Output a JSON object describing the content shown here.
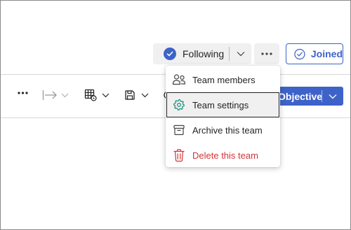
{
  "header": {
    "following": {
      "label": "Following",
      "checked": true
    },
    "more_label": "More options",
    "joined": {
      "label": "Joined"
    }
  },
  "toolbar": {
    "objective_label": "Objective"
  },
  "menu": {
    "items": [
      {
        "label": "Team members",
        "icon": "people-icon",
        "state": "default"
      },
      {
        "label": "Team settings",
        "icon": "gear-icon",
        "state": "focused"
      },
      {
        "label": "Archive this team",
        "icon": "archive-icon",
        "state": "default"
      },
      {
        "label": "Delete this team",
        "icon": "trash-icon",
        "state": "danger"
      }
    ]
  },
  "colors": {
    "accent": "#3e63c8",
    "danger": "#d13438",
    "settings_icon": "#1a8a7a",
    "button_bg": "#f0f0f0"
  }
}
